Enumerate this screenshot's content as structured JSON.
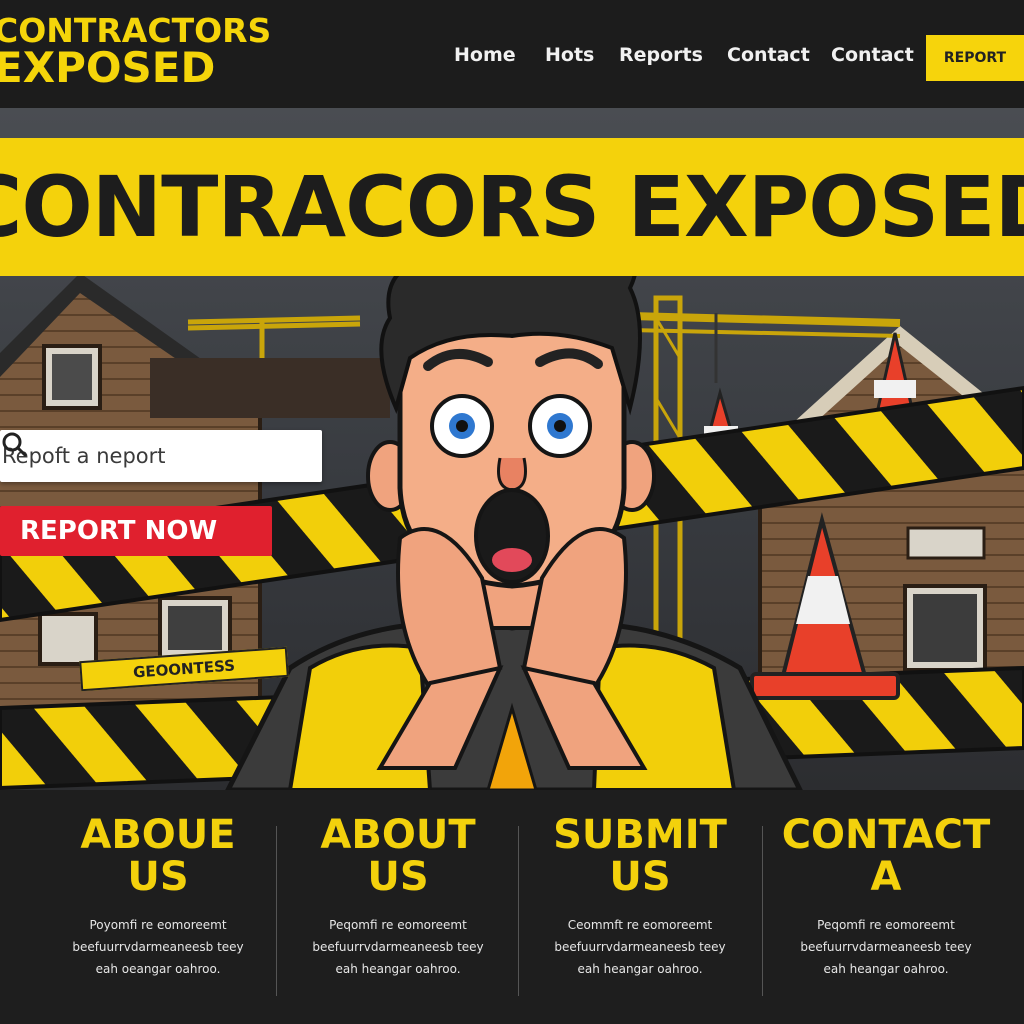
{
  "logo": {
    "line1": "CONTRACTORS",
    "line2": "EXPOSED"
  },
  "nav": {
    "links": [
      "Home",
      "Hots",
      "Reports",
      "Contact",
      "Contact"
    ],
    "button": "REPORT"
  },
  "hero": {
    "banner_title": "CONTRACORS EXPOSED",
    "search": {
      "placeholder": "Repoft a neport"
    },
    "report_now": "REPORT NOW",
    "tape_sign": "GEOONTESS"
  },
  "cards": [
    {
      "title_line1": "ABOUE",
      "title_line2": "US",
      "body": "Poyomfi re eomoreemt beefuurrvdarmeaneesb teey eah oeangar oahroo."
    },
    {
      "title_line1": "ABOUT",
      "title_line2": "US",
      "body": "Peqomfi re eomoreemt beefuurrvdarmeaneesb teey eah heangar oahroo."
    },
    {
      "title_line1": "SUBMIT",
      "title_line2": "US",
      "body": "Ceommft re eomoreemt beefuurrvdarmeaneesb teey eah heangar oahroo."
    },
    {
      "title_line1": "CONTACT",
      "title_line2": "A",
      "body": "Peqomfi re eomoreemt beefuurrvdarmeaneesb teey eah heangar oahroo."
    }
  ],
  "colors": {
    "accent": "#f4d20c",
    "danger": "#e0202e",
    "dark": "#1c1c1c"
  }
}
